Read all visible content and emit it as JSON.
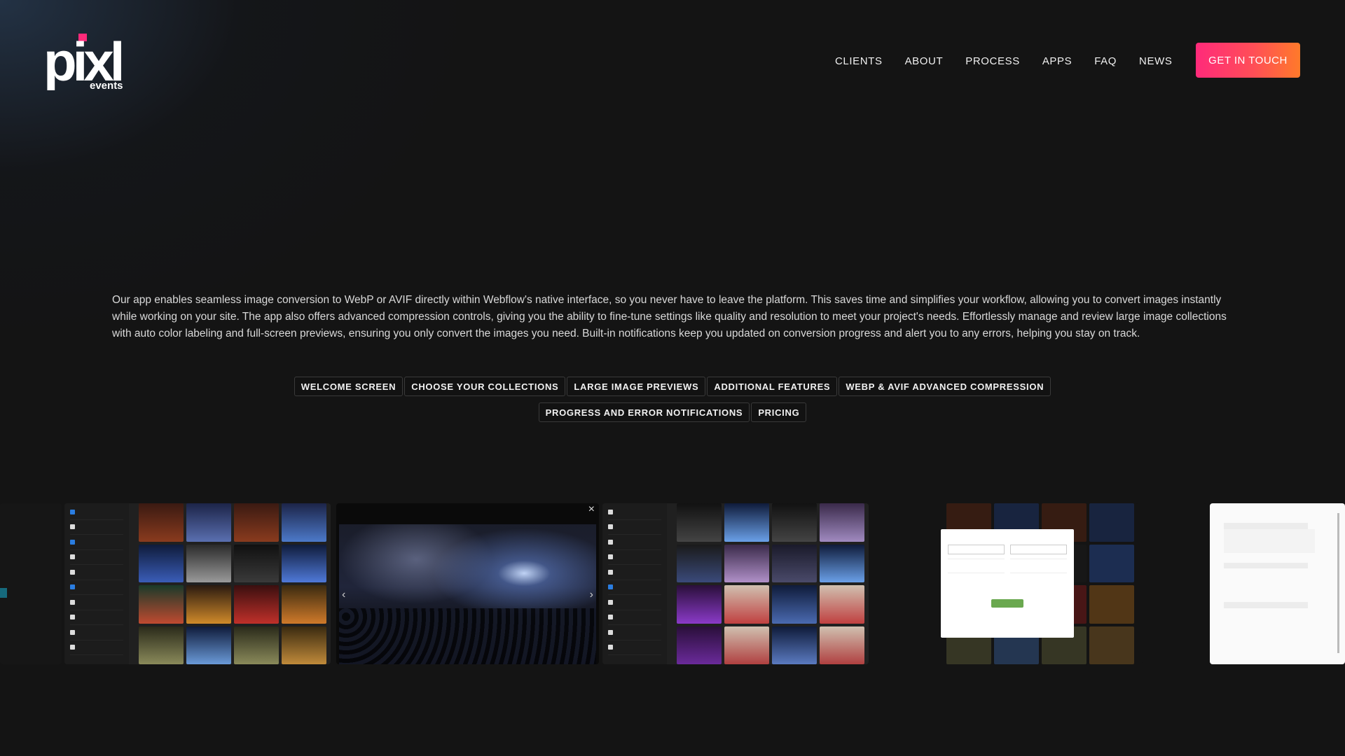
{
  "brand": {
    "logo_word": "pixl",
    "logo_sub": "events",
    "accent_pink": "#ff2a7a",
    "accent_orange": "#ff7a2a"
  },
  "nav": {
    "items": [
      "CLIENTS",
      "ABOUT",
      "PROCESS",
      "APPS",
      "FAQ",
      "NEWS"
    ],
    "cta": "GET IN TOUCH"
  },
  "hero": {
    "description": "Our app enables seamless image conversion to WebP or AVIF directly within Webflow's native interface, so you never have to leave the platform. This saves time and simplifies your workflow, allowing you to convert images instantly while working on your site. The app also offers advanced compression controls, giving you the ability to fine-tune settings like quality and resolution to meet your project's needs. Effortlessly manage and review large image collections with auto color labeling and full-screen previews, ensuring you only convert the images you need. Built-in notifications keep you updated on conversion progress and alert you to any errors, helping you stay on track."
  },
  "feature_tabs": {
    "row1": [
      "WELCOME SCREEN",
      "CHOOSE YOUR COLLECTIONS",
      "LARGE IMAGE PREVIEWS",
      "ADDITIONAL FEATURES",
      "WEBP & AVIF ADVANCED COMPRESSION"
    ],
    "row2": [
      "PROGRESS AND ERROR NOTIFICATIONS",
      "PRICING"
    ]
  },
  "carousel": {
    "close_glyph": "×",
    "prev_glyph": "‹",
    "next_glyph": "›"
  }
}
